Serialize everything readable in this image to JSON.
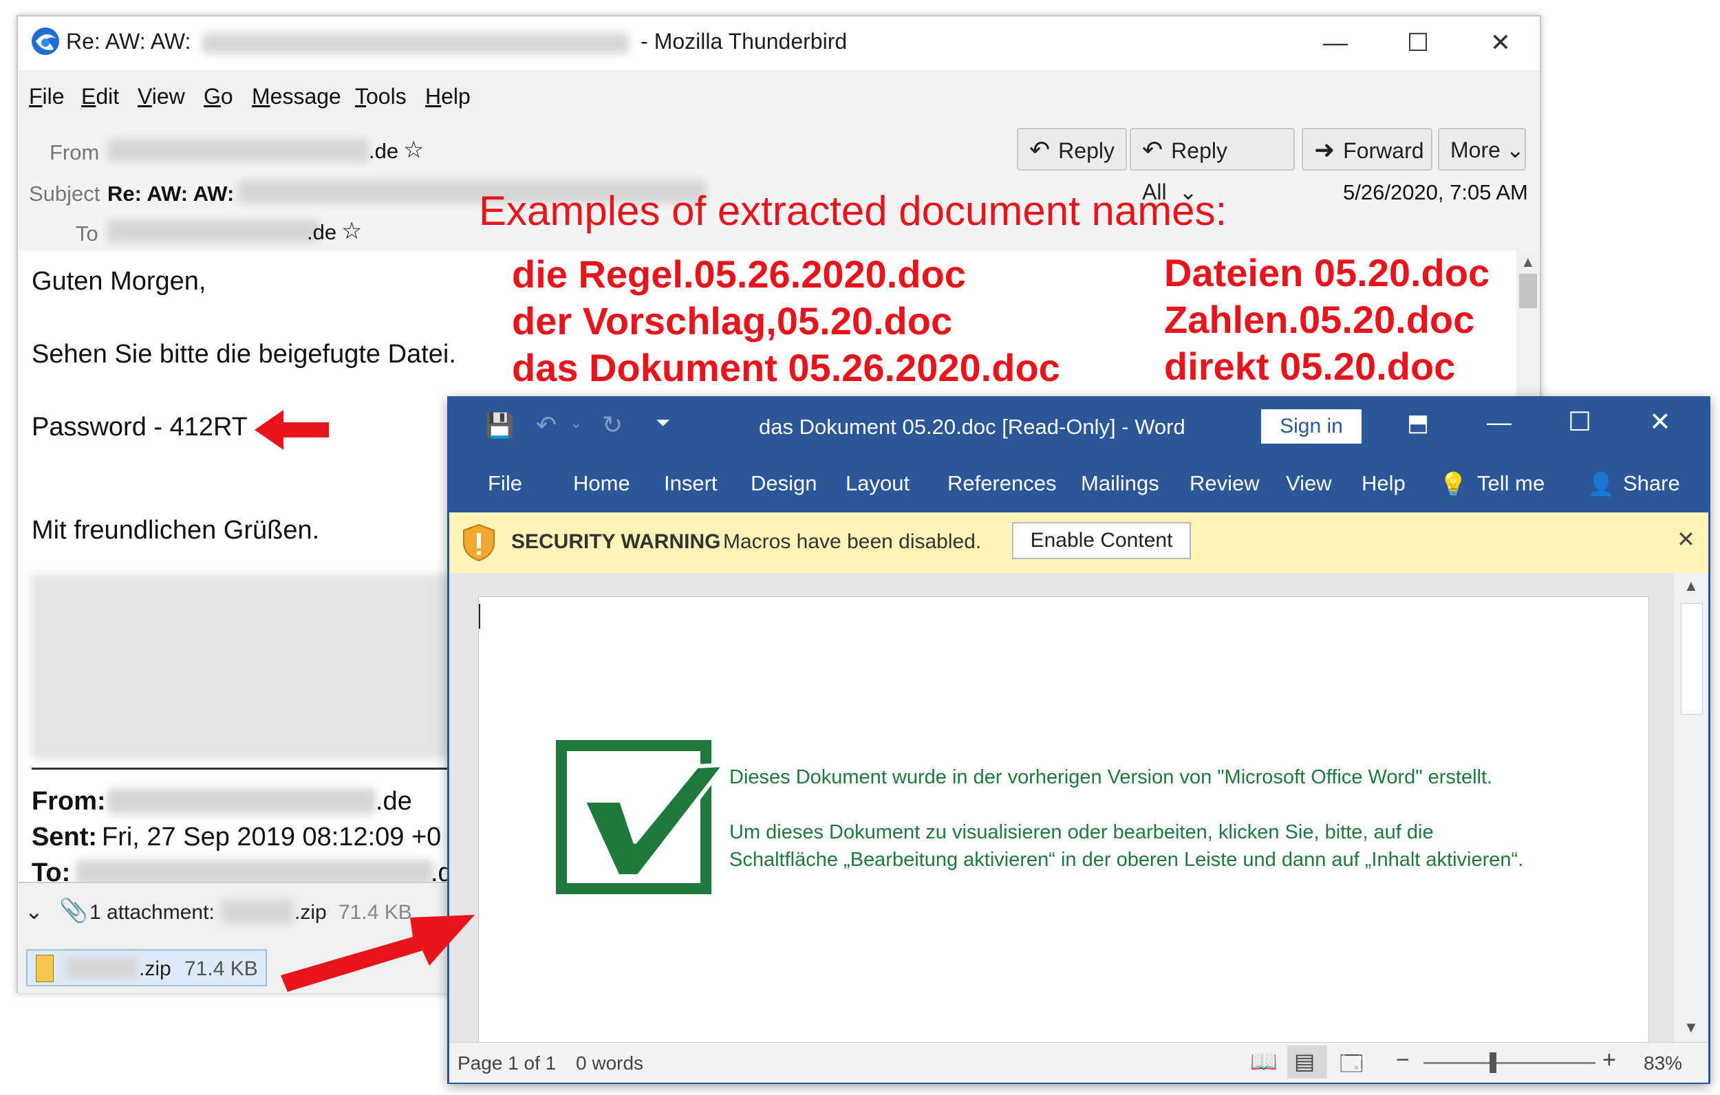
{
  "thunderbird": {
    "title_prefix": "Re: AW: AW:",
    "title_suffix": "- Mozilla Thunderbird",
    "menu": [
      "File",
      "Edit",
      "View",
      "Go",
      "Message",
      "Tools",
      "Help"
    ],
    "header": {
      "from_label": "From",
      "from_value": ".de",
      "subject_label": "Subject",
      "subject_value": "Re: AW: AW:",
      "to_label": "To",
      "to_value": ".de",
      "date": "5/26/2020, 7:05 AM"
    },
    "buttons": {
      "reply": "Reply",
      "reply_all": "Reply All",
      "forward": "Forward",
      "more": "More"
    },
    "body": {
      "greeting": "Guten Morgen,",
      "line1": "Sehen Sie bitte die beigefugte Datei.",
      "password": "Password - 412RT",
      "closing": "Mit freundlichen Grüßen."
    },
    "forwarded": {
      "from_label": "From:",
      "from_value": ".de",
      "sent_label": "Sent:",
      "sent_value": "Fri, 27 Sep 2019 08:12:09 +0",
      "to_label": "To:",
      "to_value": ".de"
    },
    "attachment": {
      "summary": "1 attachment:",
      "ext": ".zip",
      "size": "71.4 KB",
      "chip_ext": ".zip",
      "chip_size": "71.4 KB"
    }
  },
  "annotation": {
    "title": "Examples of extracted document names:",
    "names_left": [
      "die Regel.05.26.2020.doc",
      "der Vorschlag,05.20.doc",
      "das Dokument 05.26.2020.doc"
    ],
    "names_right": [
      "Dateien 05.20.doc",
      "Zahlen.05.20.doc",
      "direkt 05.20.doc"
    ]
  },
  "word": {
    "title": "das Dokument 05.20.doc [Read-Only]  -  Word",
    "sign_in": "Sign in",
    "tabs": [
      "File",
      "Home",
      "Insert",
      "Design",
      "Layout",
      "References",
      "Mailings",
      "Review",
      "View",
      "Help"
    ],
    "tell_me": "Tell me",
    "share": "Share",
    "warning_title": "SECURITY WARNING",
    "warning_text": "Macros have been disabled.",
    "enable_button": "Enable Content",
    "doc_line1": "Dieses Dokument wurde in der vorherigen Version von \"Microsoft Office Word\" erstellt.",
    "doc_line2": "Um dieses Dokument zu visualisieren oder bearbeiten, klicken Sie, bitte, auf die",
    "doc_line3": "Schaltfläche „Bearbeitung aktivieren“ in der oberen Leiste und dann auf „Inhalt aktivieren“.",
    "status_page": "Page 1 of 1",
    "status_words": "0 words",
    "zoom": "83%"
  },
  "colors": {
    "word_blue": "#2b579a",
    "annotation_red": "#e8141c",
    "doc_green": "#1e7a3c",
    "warning_bg": "#fff4b8"
  }
}
